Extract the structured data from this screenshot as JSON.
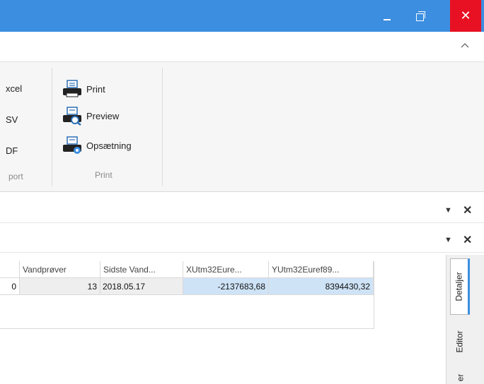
{
  "window": {
    "minimize_label": "minimize",
    "restore_label": "restore",
    "close_glyph": "✕"
  },
  "ribbon": {
    "export_items": [
      "xcel",
      "SV",
      "DF"
    ],
    "export_group_label": "port",
    "print_commands": [
      {
        "label": "Print",
        "icon": "printer-icon"
      },
      {
        "label": "Preview",
        "icon": "print-preview-icon"
      },
      {
        "label": "Opsætning",
        "icon": "print-setup-icon"
      }
    ],
    "print_group_label": "Print"
  },
  "panels": {
    "pin_glyph": "▼",
    "close_glyph": "✕"
  },
  "grid": {
    "columns": [
      "",
      "Vandprøver",
      "Sidste Vand...",
      "XUtm32Eure...",
      "YUtm32Euref89..."
    ],
    "row": [
      "0",
      "13",
      "2018.05.17",
      "-2137683,68",
      "8394430,32"
    ]
  },
  "side_tabs": [
    "Detaljer",
    "Editor",
    "er"
  ],
  "colors": {
    "titlebar": "#3c8ee0",
    "close": "#e81123",
    "selection": "#cfe3f7"
  }
}
